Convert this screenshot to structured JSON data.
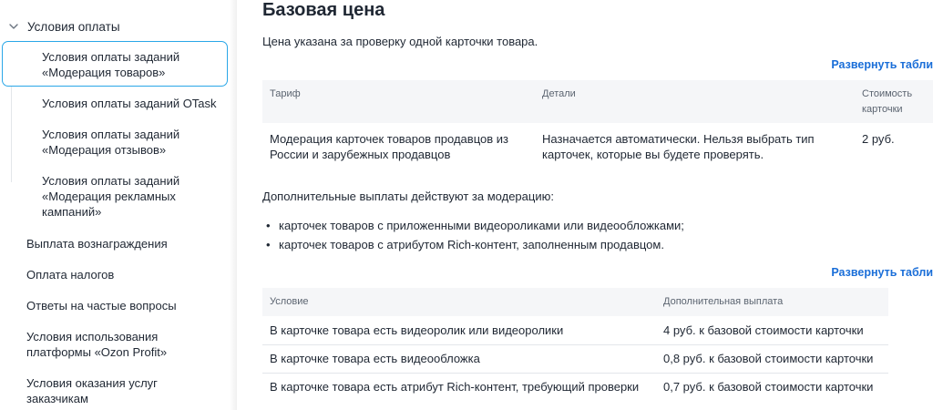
{
  "sidebar": {
    "section_label": "Условия оплаты",
    "sub_items": [
      {
        "label": "Условия оплаты заданий «Модерация товаров»",
        "active": true
      },
      {
        "label": "Условия оплаты заданий OTask",
        "active": false
      },
      {
        "label": "Условия оплаты заданий «Модерация отзывов»",
        "active": false
      },
      {
        "label": "Условия оплаты заданий «Модерация рекламных кампаний»",
        "active": false
      }
    ],
    "items": [
      {
        "label": "Выплата вознаграждения"
      },
      {
        "label": "Оплата налогов"
      },
      {
        "label": "Ответы на частые вопросы"
      },
      {
        "label": "Условия использования платформы «Ozon Profit»"
      },
      {
        "label": "Условия оказания услуг заказчикам"
      }
    ],
    "colors": {
      "active_border": "#2aa7e8"
    }
  },
  "main": {
    "title": "Базовая цена",
    "intro": "Цена указана за проверку одной карточки товара.",
    "expand_label": "Развернуть табли",
    "table1": {
      "headers": [
        "Тариф",
        "Детали",
        "Стоимость карточки"
      ],
      "rows": [
        [
          "Модерация карточек товаров продавцов из России и зарубежных продавцов",
          "Назначается автоматически. Нельзя выбрать тип карточек, которые вы будете проверять.",
          "2 руб."
        ]
      ]
    },
    "extra_payments_text": "Дополнительные выплаты действуют за модерацию:",
    "bullets": [
      "карточек товаров с приложенными видеороликами или видеообложками;",
      "карточек товаров с атрибутом Rich-контент, заполненным продавцом."
    ],
    "table2": {
      "headers": [
        "Условие",
        "Дополнительная выплата"
      ],
      "rows": [
        [
          "В карточке товара есть видеоролик или видеоролики",
          "4 руб. к базовой стоимости карточки"
        ],
        [
          "В карточке товара есть видеообложка",
          "0,8 руб. к базовой стоимости карточки"
        ],
        [
          "В карточке товара есть атрибут Rich-контент, требующий проверки",
          "0,7 руб. к базовой стоимости карточки"
        ]
      ]
    },
    "colors": {
      "link": "#1a6ed8",
      "table_header_bg": "#f5f6f8",
      "text": "#1f2733",
      "muted": "#5b6470"
    }
  }
}
